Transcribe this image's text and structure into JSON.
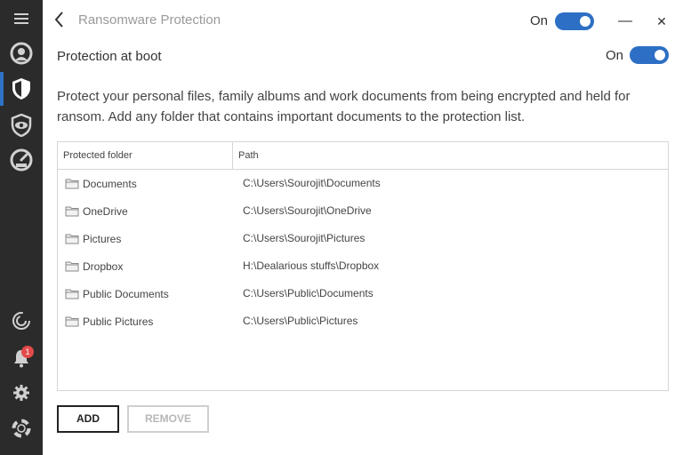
{
  "window": {
    "title": "Ransomware Protection",
    "main_toggle_label": "On",
    "minimize_glyph": "—",
    "close_glyph": "✕"
  },
  "sidebar": {
    "items": [
      {
        "icon": "menu-icon"
      },
      {
        "icon": "user-icon"
      },
      {
        "icon": "shield-icon",
        "active": true
      },
      {
        "icon": "privacy-eye-shield-icon"
      },
      {
        "icon": "speedometer-icon"
      },
      {
        "icon": "spiral-icon"
      },
      {
        "icon": "bell-icon",
        "badge": "1"
      },
      {
        "icon": "gear-icon"
      },
      {
        "icon": "lifebuoy-icon"
      }
    ],
    "notification_badge": "1",
    "accent": "#2d72c5"
  },
  "boot": {
    "label": "Protection at boot",
    "toggle_label": "On"
  },
  "description": "Protect your personal files, family albums and work documents from being encrypted and held for ransom. Add any folder that contains important documents to the protection list.",
  "table": {
    "headers": {
      "folder": "Protected folder",
      "path": "Path"
    },
    "rows": [
      {
        "folder": "Documents",
        "path": "C:\\Users\\Sourojit\\Documents"
      },
      {
        "folder": "OneDrive",
        "path": "C:\\Users\\Sourojit\\OneDrive"
      },
      {
        "folder": "Pictures",
        "path": "C:\\Users\\Sourojit\\Pictures"
      },
      {
        "folder": "Dropbox",
        "path": "H:\\Dealarious stuffs\\Dropbox"
      },
      {
        "folder": "Public Documents",
        "path": "C:\\Users\\Public\\Documents"
      },
      {
        "folder": "Public Pictures",
        "path": "C:\\Users\\Public\\Pictures"
      }
    ]
  },
  "buttons": {
    "add": "ADD",
    "remove": "REMOVE"
  },
  "colors": {
    "toggle_on": "#2d6fc4",
    "sidebar_bg": "#2b2b2b",
    "badge": "#e24a4a"
  }
}
